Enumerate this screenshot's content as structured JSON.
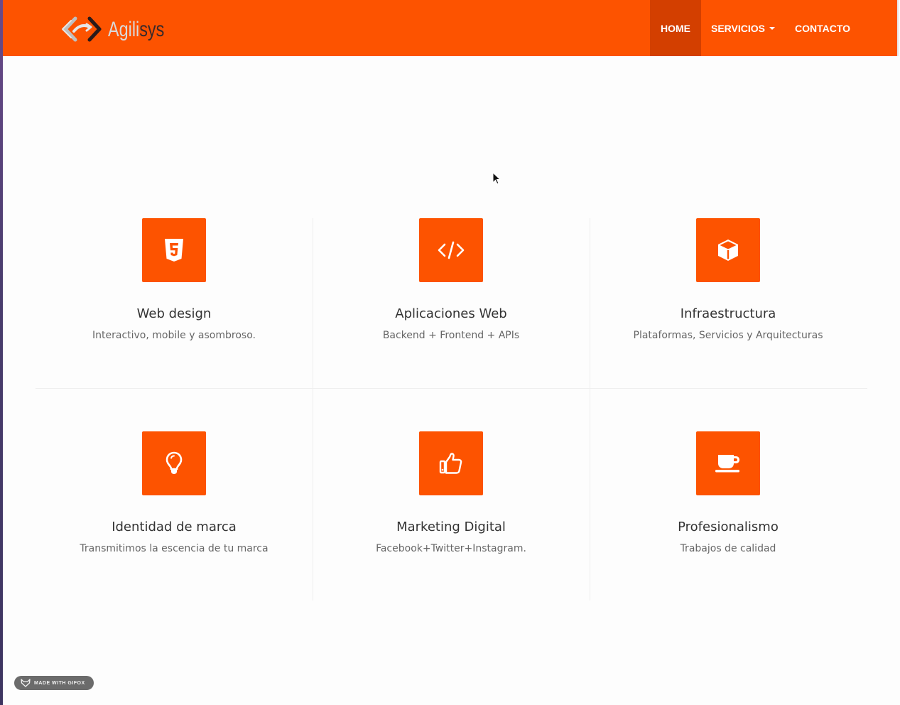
{
  "brand": {
    "name_part1": "Agili",
    "name_part2": "sys",
    "colors": {
      "part1": "#d9d9d9",
      "part2": "#3a2a2a",
      "accent": "#fd5300"
    }
  },
  "nav": {
    "items": [
      {
        "label": "HOME",
        "active": true
      },
      {
        "label": "SERVICIOS",
        "dropdown": true
      },
      {
        "label": "CONTACTO"
      }
    ]
  },
  "services": [
    {
      "icon": "html5-icon",
      "title": "Web design",
      "description": "Interactivo, mobile y asombroso."
    },
    {
      "icon": "code-icon",
      "title": "Aplicaciones Web",
      "description": "Backend + Frontend + APIs"
    },
    {
      "icon": "cube-icon",
      "title": "Infraestructura",
      "description": "Plataformas, Servicios y Arquitecturas"
    },
    {
      "icon": "lightbulb-icon",
      "title": "Identidad de marca",
      "description": "Transmitimos la escencia de tu marca"
    },
    {
      "icon": "thumbs-up-icon",
      "title": "Marketing Digital",
      "description": "Facebook+Twitter+Instagram."
    },
    {
      "icon": "coffee-cup-icon",
      "title": "Profesionalismo",
      "description": "Trabajos de calidad"
    }
  ],
  "watermark": {
    "text": "MADE WITH GIFOX"
  },
  "colors": {
    "primary": "#fd5300",
    "nav_active": "#d33f00"
  }
}
